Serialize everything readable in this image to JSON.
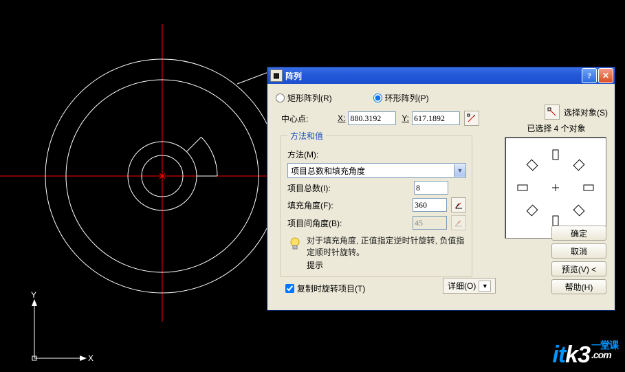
{
  "dialog": {
    "title": "阵列",
    "help_tooltip": "?",
    "close_tooltip": "X",
    "radio_rect": "矩形阵列(R)",
    "radio_polar": "环形阵列(P)",
    "array_type": "polar",
    "select_objects": "选择对象(S)",
    "selection_count": "已选择 4 个对象",
    "center_label": "中心点:",
    "x_label": "X:",
    "y_label": "Y:",
    "x_value": "880.3192",
    "y_value": "617.1892",
    "fieldset": {
      "legend": "方法和值",
      "method_label": "方法(M):",
      "method_value": "项目总数和填充角度",
      "total_label": "项目总数(I):",
      "total_value": "8",
      "fill_angle_label": "填充角度(F):",
      "fill_angle_value": "360",
      "item_angle_label": "项目间角度(B):",
      "item_angle_value": "45",
      "tip_heading": "提示",
      "tip_text": "对于填充角度, 正值指定逆时针旋转, 负值指定顺时针旋转。"
    },
    "rotate_label": "复制时旋转项目(T)",
    "details_label": "详细(O)",
    "buttons": {
      "ok": "确定",
      "cancel": "取消",
      "preview": "预览(V) <",
      "help": "帮助(H)"
    }
  },
  "canvas": {
    "y_axis": "Y",
    "x_axis": "X"
  },
  "watermark": {
    "a": "it",
    "b": "k3",
    "cn": "一堂课",
    "com": ".com"
  }
}
